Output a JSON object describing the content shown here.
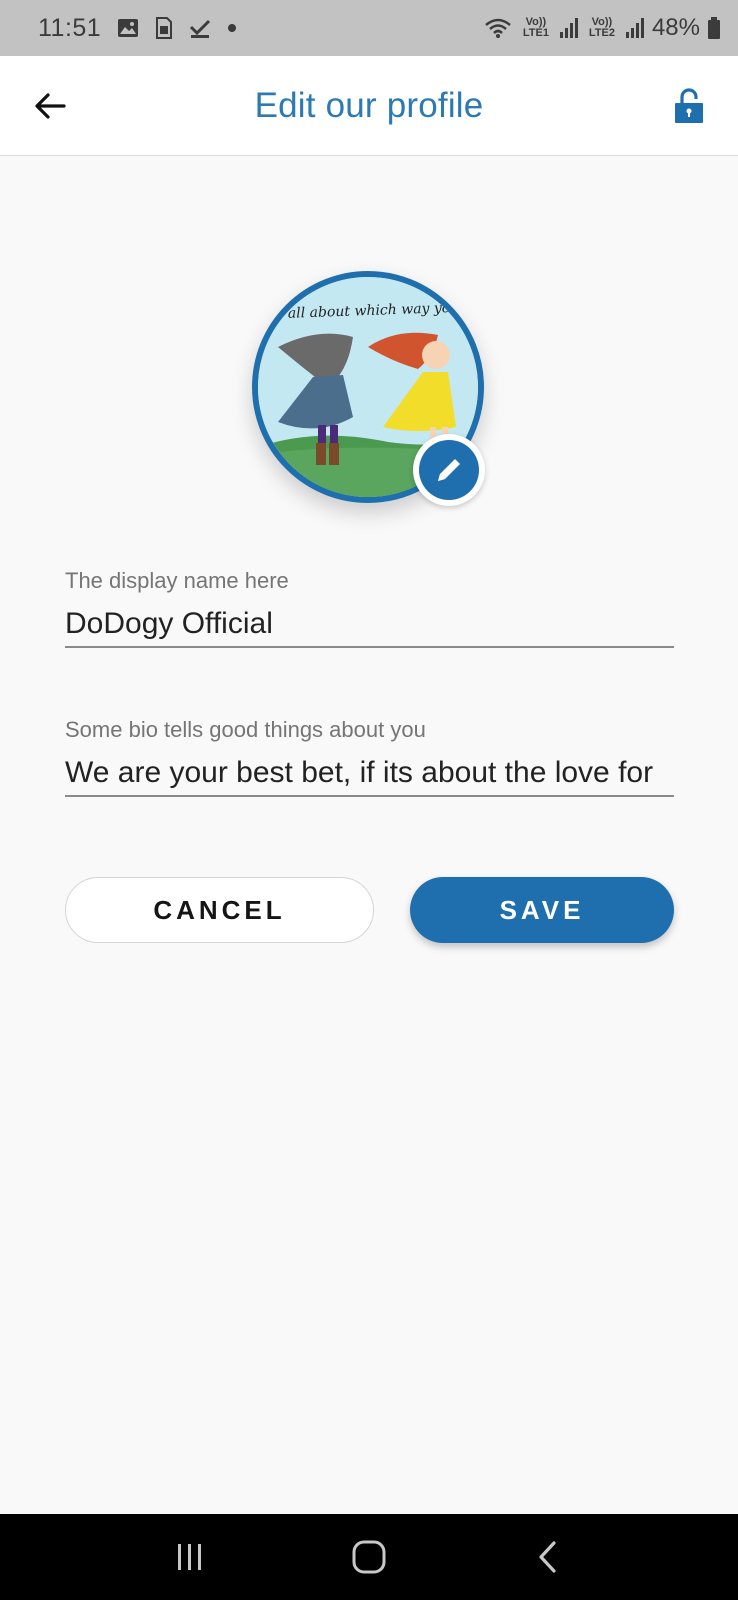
{
  "status_bar": {
    "time": "11:51",
    "battery": "48%",
    "sim1_label": "Vo)) LTE1",
    "sim2_label": "Vo)) LTE2",
    "left_icons": [
      "image-icon",
      "sim-card-icon",
      "check-icon",
      "dot-icon"
    ]
  },
  "app_bar": {
    "title": "Edit our profile",
    "back_icon": "arrow-left-icon",
    "lock_icon": "unlocked-padlock-icon"
  },
  "avatar": {
    "caption_text": "all about which way yo",
    "edit_icon": "pencil-icon"
  },
  "form": {
    "display_name": {
      "label": "The display name here",
      "value": "DoDogy Official"
    },
    "bio": {
      "label": "Some bio tells good things about you",
      "value": "We are your best bet, if its about the love for"
    }
  },
  "buttons": {
    "cancel_label": "CANCEL",
    "save_label": "SAVE"
  },
  "nav_bar": {
    "icons": [
      "recent-apps-icon",
      "home-icon",
      "back-icon"
    ]
  },
  "colors": {
    "accent": "#1f6fae",
    "title": "#2b7ab3",
    "status_bar_bg": "#c2c2c2",
    "background": "#f9f9f9"
  }
}
